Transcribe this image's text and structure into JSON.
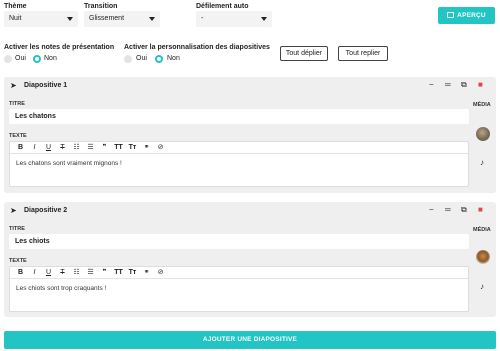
{
  "settings": {
    "theme": {
      "label": "Thème",
      "value": "Nuit"
    },
    "transition": {
      "label": "Transition",
      "value": "Glissement"
    },
    "autoscroll": {
      "label": "Défilement auto",
      "value": "-"
    },
    "preview_label": "APERÇU",
    "notes": {
      "label": "Activer les notes de présentation",
      "yes": "Oui",
      "no": "Non",
      "selected": "Non"
    },
    "custom": {
      "label": "Activer la personnalisation des diapositives",
      "yes": "Oui",
      "no": "Non",
      "selected": "Non"
    },
    "expand_all_label": "Tout déplier",
    "collapse_all_label": "Tout replier"
  },
  "slides": [
    {
      "heading": "Diapositive 1",
      "title_label": "TITRE",
      "title_value": "Les chatons",
      "text_label": "TEXTE",
      "text_value": "Les chatons sont vraiment mignons !",
      "media_label": "MÉDIA",
      "image_icon": "kitten-photo-thumbnail",
      "audio_icon": "music-note-icon"
    },
    {
      "heading": "Diapositive 2",
      "title_label": "TITRE",
      "title_value": "Les chiots",
      "text_label": "TEXTE",
      "text_value": "Les chiots sont trop craquants !",
      "media_label": "MÉDIA",
      "image_icon": "puppy-photo-thumbnail",
      "audio_icon": "music-note-icon"
    }
  ],
  "toolbar": {
    "bold": "B",
    "italic": "I",
    "underline": "U",
    "strike": "T",
    "ordered_list": "☷",
    "bullet_list": "☰",
    "quote": "❞",
    "heading_large": "TT",
    "heading_small": "Tт",
    "link": "⚭",
    "unlink": "⊘"
  },
  "add_slide_label": "AJOUTER UNE DIAPOSITIVE",
  "colors": {
    "accent": "#23c4c4",
    "delete": "#e0454b",
    "card_bg": "#efefef"
  }
}
